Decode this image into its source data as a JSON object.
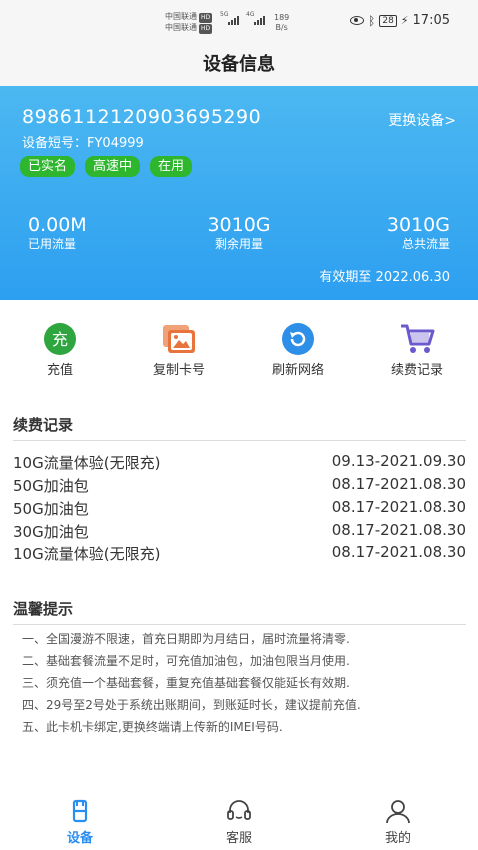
{
  "status_bar": {
    "carrier_1": "中国联通",
    "carrier_2": "中国联通",
    "hd_tag": "HD",
    "net_1": "5G",
    "net_2": "4G",
    "speed_value": "189",
    "speed_unit": "B/s",
    "battery": "28",
    "time": "17:05"
  },
  "nav": {
    "title": "设备信息"
  },
  "device": {
    "iccid": "8986112120903695290",
    "short_code": "设备短号：FY04999",
    "change_device": "更换设备>",
    "badges": [
      "已实名",
      "高速中",
      "在用"
    ],
    "used_value": "0.00M",
    "used_label": "已用流量",
    "remaining_value": "3010G",
    "remaining_label": "剩余用量",
    "total_value": "3010G",
    "total_label": "总共流量",
    "validity": "有效期至 2022.06.30"
  },
  "actions": [
    {
      "label": "充值",
      "icon": "recharge-icon"
    },
    {
      "label": "复制卡号",
      "icon": "copy-card-icon"
    },
    {
      "label": "刷新网络",
      "icon": "refresh-icon"
    },
    {
      "label": "续费记录",
      "icon": "cart-icon"
    }
  ],
  "records": {
    "title": "续费记录",
    "rows": [
      {
        "name": "10G流量体验(无限充)",
        "date": "09.13-2021.09.30"
      },
      {
        "name": "50G加油包",
        "date": "08.17-2021.08.30"
      },
      {
        "name": "50G加油包",
        "date": "08.17-2021.08.30"
      },
      {
        "name": "30G加油包",
        "date": "08.17-2021.08.30"
      },
      {
        "name": "10G流量体验(无限充)",
        "date": "08.17-2021.08.30"
      }
    ]
  },
  "tips": {
    "title": "温馨提示",
    "rows": [
      "一、全国漫游不限速，首充日期即为月结日，届时流量将清零.",
      "二、基础套餐流量不足时，可充值加油包，加油包限当月使用.",
      "三、须充值一个基础套餐，重复充值基础套餐仅能延长有效期.",
      "四、29号至2号处于系统出账期间，到账延时长，建议提前充值.",
      "五、此卡机卡绑定,更换终端请上传新的IMEI号码."
    ]
  },
  "tabs": [
    {
      "label": "设备",
      "icon": "device-icon",
      "active": true
    },
    {
      "label": "客服",
      "icon": "headset-icon",
      "active": false
    },
    {
      "label": "我的",
      "icon": "user-icon",
      "active": false
    }
  ],
  "colors": {
    "card_gradient_top": "#4cb8f1",
    "card_gradient_bottom": "#2d9ff0",
    "badge_green": "#2db62e",
    "tab_active": "#2a8ef0"
  }
}
